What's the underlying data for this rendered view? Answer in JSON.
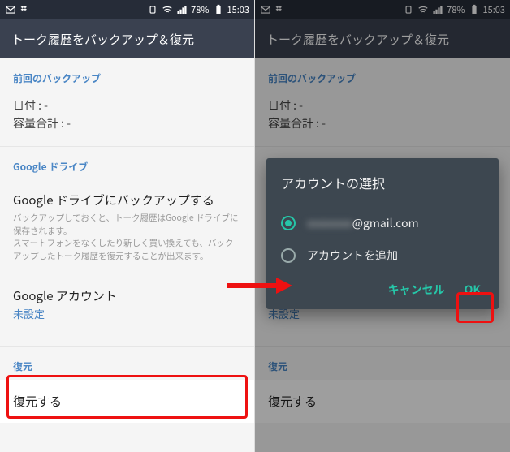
{
  "status": {
    "battery_pct": "78%",
    "time": "15:03"
  },
  "appbar": {
    "title": "トーク履歴をバックアップ＆復元"
  },
  "section_backup": {
    "title": "前回のバックアップ",
    "date_label": "日付 : -",
    "size_label": "容量合計 : -"
  },
  "section_drive": {
    "title": "Google ドライブ",
    "row1_title": "Google ドライブにバックアップする",
    "row1_sub": "バックアップしておくと、トーク履歴はGoogle ドライブに保存されます。\nスマートフォンをなくしたり新しく買い換えても、バックアップしたトーク履歴を復元することが出来ます。",
    "row2_title": "Google アカウント",
    "row2_value": "未設定"
  },
  "section_restore": {
    "title": "復元",
    "action": "復元する"
  },
  "dialog": {
    "title": "アカウントの選択",
    "option_account": "@gmail.com",
    "option_add": "アカウントを追加",
    "cancel": "キャンセル",
    "ok": "OK"
  }
}
